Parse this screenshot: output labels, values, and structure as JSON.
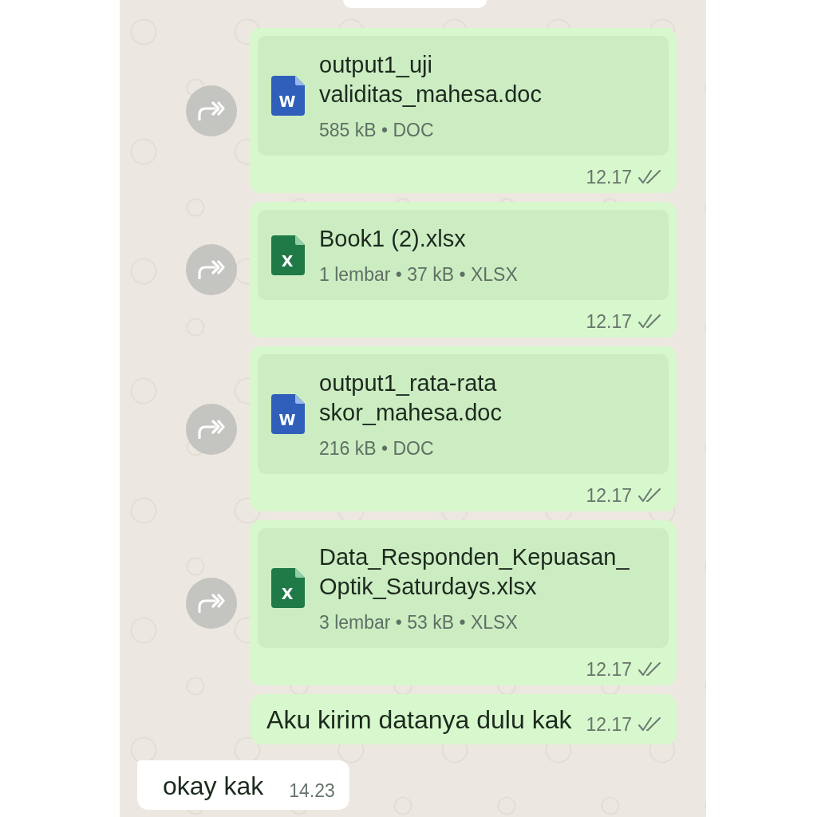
{
  "chat": {
    "messages": [
      {
        "kind": "document",
        "outgoing": true,
        "forward_button": true,
        "file": {
          "kind": "doc",
          "icon_letter": "W",
          "name": "output1_uji validitas_mahesa.doc",
          "details": "585 kB • DOC"
        },
        "time": "12.17",
        "read": false
      },
      {
        "kind": "document",
        "outgoing": true,
        "forward_button": true,
        "file": {
          "kind": "xlsx",
          "icon_letter": "X",
          "name": "Book1 (2).xlsx",
          "details": "1 lembar • 37 kB • XLSX"
        },
        "time": "12.17",
        "read": false
      },
      {
        "kind": "document",
        "outgoing": true,
        "forward_button": true,
        "file": {
          "kind": "doc",
          "icon_letter": "W",
          "name": "output1_rata-rata skor_mahesa.doc",
          "details": "216 kB • DOC"
        },
        "time": "12.17",
        "read": false
      },
      {
        "kind": "document",
        "outgoing": true,
        "forward_button": true,
        "file": {
          "kind": "xlsx",
          "icon_letter": "X",
          "name": "Data_Responden_Kepuasan_Optik_Saturdays.xlsx",
          "details": "3 lembar • 53 kB • XLSX"
        },
        "time": "12.17",
        "read": false
      },
      {
        "kind": "text",
        "outgoing": true,
        "text": "Aku kirim datanya dulu kak",
        "time": "12.17",
        "read": false
      },
      {
        "kind": "text",
        "outgoing": false,
        "text": "okay kak",
        "time": "14.23"
      }
    ]
  }
}
